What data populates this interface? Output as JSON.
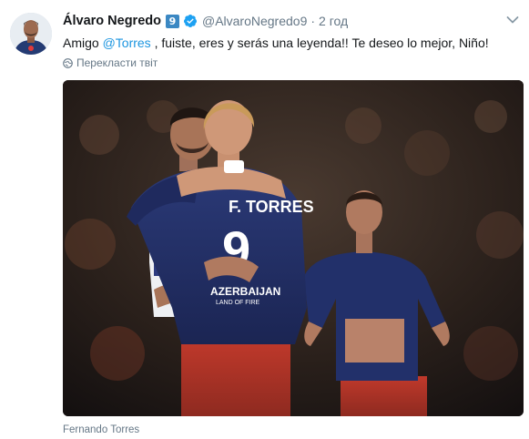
{
  "tweet": {
    "author_name": "Álvaro Negredo",
    "flag_badge": "9",
    "handle": "@AlvaroNegredo9",
    "separator": "·",
    "time": "2 год",
    "text_before": "Amigo ",
    "mention": "@Torres",
    "text_after": " , fuiste, eres y serás una leyenda!! Te deseo lo mejor, Niño!",
    "translate_label": "Перекласти твіт",
    "media_caption": "Fernando Torres",
    "jersey_name": "F. TORRES",
    "jersey_number": "9",
    "sponsor_line1": "AZERBAIJAN",
    "sponsor_line2": "LAND OF FIRE"
  },
  "colors": {
    "link": "#1b95e0",
    "secondary_text": "#657786",
    "verified": "#1da1f2",
    "flag_badge_bg": "#3b88c3"
  },
  "icons": {
    "verified": "verified-check-icon",
    "menu": "chevron-down-icon",
    "translate": "globe-icon"
  }
}
